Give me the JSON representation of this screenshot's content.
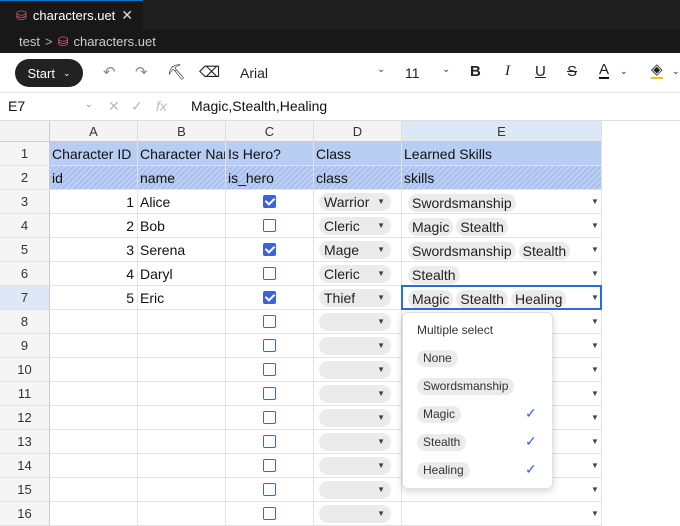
{
  "tab": {
    "title": "characters.uet",
    "close": "✕"
  },
  "breadcrumb": {
    "folder": "test",
    "separator": ">",
    "file": "characters.uet"
  },
  "toolbar": {
    "start_label": "Start",
    "font": "Arial",
    "font_size": "11",
    "icons": [
      "undo-icon",
      "redo-icon",
      "format-painter-icon",
      "clear-format-icon",
      "bold-icon",
      "italic-icon",
      "underline-icon",
      "strikethrough-icon",
      "font-color-icon",
      "fill-color-icon"
    ]
  },
  "formula_bar": {
    "cell_ref": "E7",
    "value": "Magic,Stealth,Healing"
  },
  "columns": [
    "A",
    "B",
    "C",
    "D",
    "E"
  ],
  "rows": [
    "1",
    "2",
    "3",
    "4",
    "5",
    "6",
    "7",
    "8",
    "9",
    "10",
    "11",
    "12",
    "13",
    "14",
    "15",
    "16"
  ],
  "header_row": [
    "Character ID",
    "Character Name",
    "Is Hero?",
    "Class",
    "Learned Skills"
  ],
  "key_row": [
    "id",
    "name",
    "is_hero",
    "class",
    "skills"
  ],
  "records": [
    {
      "id": "1",
      "name": "Alice",
      "hero": true,
      "class": "Warrior",
      "skills": [
        "Swordsmanship"
      ]
    },
    {
      "id": "2",
      "name": "Bob",
      "hero": false,
      "class": "Cleric",
      "skills": [
        "Magic",
        "Stealth"
      ]
    },
    {
      "id": "3",
      "name": "Serena",
      "hero": true,
      "class": "Mage",
      "skills": [
        "Swordsmanship",
        "Stealth"
      ]
    },
    {
      "id": "4",
      "name": "Daryl",
      "hero": false,
      "class": "Cleric",
      "skills": [
        "Stealth"
      ]
    },
    {
      "id": "5",
      "name": "Eric",
      "hero": true,
      "class": "Thief",
      "skills": [
        "Magic",
        "Stealth",
        "Healing"
      ]
    }
  ],
  "popup": {
    "title": "Multiple select",
    "options": [
      {
        "label": "None",
        "checked": false
      },
      {
        "label": "Swordsmanship",
        "checked": false
      },
      {
        "label": "Magic",
        "checked": true
      },
      {
        "label": "Stealth",
        "checked": true
      },
      {
        "label": "Healing",
        "checked": true
      }
    ]
  },
  "colors": {
    "header": "#b8cdf2",
    "checkbox": "#3b63d8",
    "selection": "#2d6be0"
  }
}
